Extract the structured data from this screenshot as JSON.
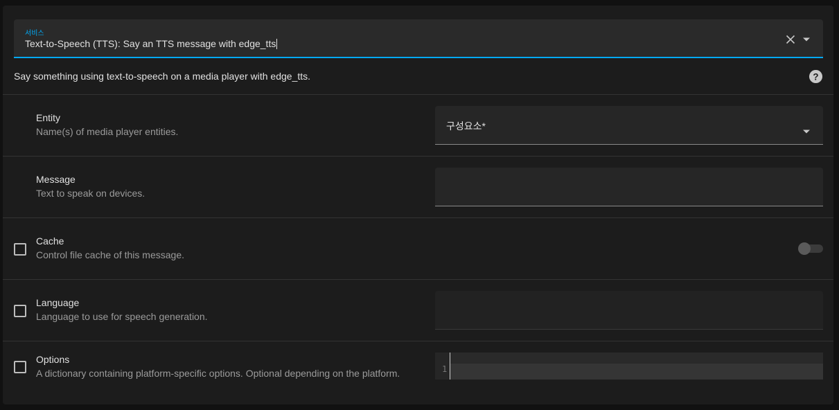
{
  "service": {
    "label": "서비스",
    "value": "Text-to-Speech (TTS): Say an TTS message with edge_tts"
  },
  "description": "Say something using text-to-speech on a media player with edge_tts.",
  "fields": {
    "entity": {
      "name": "Entity",
      "description": "Name(s) of media player entities.",
      "input_label": "구성요소*"
    },
    "message": {
      "name": "Message",
      "description": "Text to speak on devices.",
      "value": ""
    },
    "cache": {
      "name": "Cache",
      "description": "Control file cache of this message.",
      "enabled": false
    },
    "language": {
      "name": "Language",
      "description": "Language to use for speech generation.",
      "value": ""
    },
    "options": {
      "name": "Options",
      "description": "A dictionary containing platform-specific options. Optional depending on the platform.",
      "line_number": "1"
    }
  },
  "colors": {
    "accent": "#03a9f4",
    "card": "#1c1c1c",
    "background": "#111111"
  },
  "icons": [
    "close-icon",
    "chevron-down-icon",
    "help-circle-icon"
  ]
}
